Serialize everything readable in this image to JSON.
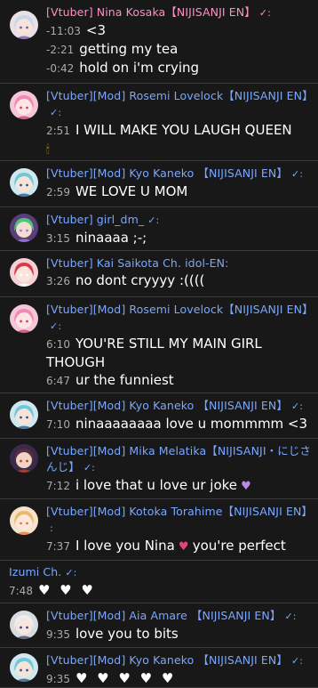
{
  "colors": {
    "background": "#181818",
    "divider": "#3a3a3a",
    "author_pink": "#ff8fc4",
    "author_blue": "#7aa7ff",
    "timestamp": "#aaaaaa",
    "text": "#ffffff"
  },
  "messages": [
    {
      "author": "[Vtuber] Nina Kosaka【NIJISANJI EN】",
      "check": "✓:",
      "author_color": "#ff8fc4",
      "avatar": "nina-avatar",
      "lines": [
        {
          "time": "-11:03",
          "text": "<3"
        },
        {
          "time": "-2:21",
          "text": "getting my tea"
        },
        {
          "time": "-0:42",
          "text": "hold on i'm crying"
        }
      ]
    },
    {
      "author": "[Vtuber][Mod] Rosemi Lovelock【NIJISANJI EN】",
      "check": "✓:",
      "author_color": "#7aa7ff",
      "avatar": "rosemi-avatar",
      "lines": [
        {
          "time": "2:51",
          "text": "I WILL MAKE YOU LAUGH QUEEN"
        },
        {
          "time": "",
          "text": "",
          "emoji": "candle"
        }
      ]
    },
    {
      "author": "[Vtuber][Mod] Kyo Kaneko 【NIJISANJI EN】",
      "check": "✓:",
      "author_color": "#7aa7ff",
      "avatar": "kyo-avatar",
      "lines": [
        {
          "time": "2:59",
          "text": "WE LOVE U MOM"
        }
      ]
    },
    {
      "author": "[Vtuber] girl_dm_",
      "check": "✓:",
      "author_color": "#7aa7ff",
      "avatar": "girl-dm-avatar",
      "lines": [
        {
          "time": "3:15",
          "text": "ninaaaa ;-;"
        }
      ]
    },
    {
      "author": "[Vtuber] Kai Saikota Ch. idol-EN:",
      "check": "",
      "author_color": "#7aa7ff",
      "avatar": "kai-avatar",
      "lines": [
        {
          "time": "3:26",
          "text": "no dont cryyyy :(((("
        }
      ]
    },
    {
      "author": "[Vtuber][Mod] Rosemi Lovelock【NIJISANJI EN】",
      "check": "✓:",
      "author_color": "#7aa7ff",
      "avatar": "rosemi-avatar",
      "lines": [
        {
          "time": "6:10",
          "text": "YOU'RE STILL MY MAIN GIRL THOUGH"
        },
        {
          "time": "6:47",
          "text": "ur the funniest"
        }
      ]
    },
    {
      "author": "[Vtuber][Mod] Kyo Kaneko 【NIJISANJI EN】",
      "check": "✓:",
      "author_color": "#7aa7ff",
      "avatar": "kyo-avatar",
      "lines": [
        {
          "time": "7:10",
          "text": "ninaaaaaaaa love u mommmm <3"
        }
      ]
    },
    {
      "author": "[Vtuber][Mod] Mika Melatika【NIJISANJI・にじさんじ】",
      "check": "✓:",
      "author_color": "#7aa7ff",
      "avatar": "mika-avatar",
      "lines": [
        {
          "time": "7:12",
          "text": "i love that u love ur joke",
          "emoji": "purple-heart"
        }
      ]
    },
    {
      "author": "[Vtuber][Mod] Kotoka Torahime【NIJISANJI EN】",
      "check": ":",
      "author_color": "#7aa7ff",
      "avatar": "kotoka-avatar",
      "lines": [
        {
          "time": "7:37",
          "text": "I love you Nina",
          "emoji": "sparkle-heart",
          "after": "you're perfect"
        }
      ]
    },
    {
      "author": "Izumi Ch.",
      "check": "✓:",
      "author_color": "#7aa7ff",
      "avatar": "",
      "lines": [
        {
          "time": "7:48",
          "text": "",
          "hearts": "♥ ♥ ♥"
        }
      ]
    },
    {
      "author": "[Vtuber][Mod] Aia Amare 【NIJISANJI EN】",
      "check": "✓:",
      "author_color": "#7aa7ff",
      "avatar": "aia-avatar",
      "lines": [
        {
          "time": "9:35",
          "text": "love you to bits"
        }
      ]
    },
    {
      "author": "[Vtuber][Mod] Kyo Kaneko 【NIJISANJI EN】",
      "check": "✓:",
      "author_color": "#7aa7ff",
      "avatar": "kyo-avatar",
      "lines": [
        {
          "time": "9:35",
          "text": "",
          "hearts": "♥ ♥ ♥ ♥ ♥"
        }
      ]
    }
  ]
}
